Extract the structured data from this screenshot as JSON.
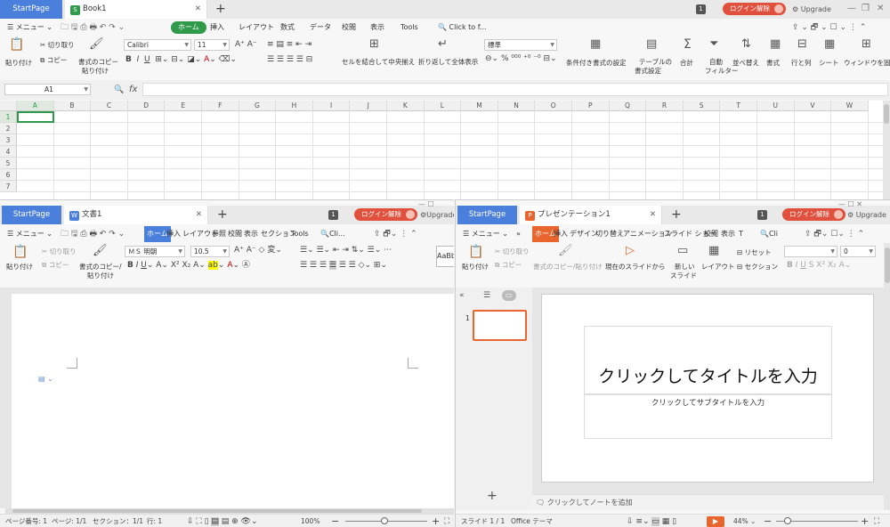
{
  "spreadsheet": {
    "tabs": {
      "start": "StartPage",
      "doc": "Book1",
      "doc_badge": "S",
      "doc_color": "#2e9a4a"
    },
    "num_badge": "1",
    "login": "ログイン解除",
    "upgrade": "Upgrade",
    "menu": {
      "menu_label": "メニュー",
      "active": "ホーム",
      "items": [
        "挿入",
        "レイアウト",
        "数式",
        "データ",
        "校閲",
        "表示",
        "Tools"
      ],
      "search": "Click to f..."
    },
    "ribbon": {
      "paste": "貼り付け",
      "cut": "切り取り",
      "copy": "コピー",
      "format_painter_1": "書式のコピー",
      "format_painter_2": "貼り付け",
      "font": "Calibri",
      "size": "11",
      "merge": "セルを結合して中央揃え",
      "wrap": "折り返して全体表示",
      "numfmt": "標準",
      "cond_fmt": "条件付き書式の設定",
      "table_fmt_1": "テーブルの",
      "table_fmt_2": "書式設定",
      "sum": "合計",
      "filter_1": "自動",
      "filter_2": "フィルター",
      "sort": "並べ替え",
      "format": "書式",
      "rowcol": "行と列",
      "sheet": "シート",
      "freeze": "ウィンドウを固定"
    },
    "namebox": "A1",
    "fx": "fx",
    "columns": [
      "A",
      "B",
      "C",
      "D",
      "E",
      "F",
      "G",
      "H",
      "I",
      "J",
      "K",
      "L",
      "M",
      "N",
      "O",
      "P",
      "Q",
      "R",
      "S",
      "T",
      "U",
      "V",
      "W"
    ],
    "rows": [
      "1",
      "2",
      "3",
      "4",
      "5",
      "6",
      "7"
    ]
  },
  "writer": {
    "tabs": {
      "start": "StartPage",
      "doc": "文書1",
      "doc_badge": "W",
      "doc_color": "#4a7fdc"
    },
    "num_badge": "1",
    "login": "ログイン解除",
    "upgrade": "Upgrade",
    "menu": {
      "menu_label": "メニュー",
      "active": "ホーム",
      "items": [
        "挿入",
        "レイアウト",
        "参照",
        "校閲",
        "表示",
        "セクション",
        "Tools"
      ],
      "search": "Cli..."
    },
    "ribbon": {
      "paste": "貼り付け",
      "cut": "切り取り",
      "copy": "コピー",
      "format_painter_1": "書式のコピー/",
      "format_painter_2": "貼り付け",
      "font": "ＭＳ 明朝",
      "size": "10.5",
      "style": "AaBb"
    },
    "status": {
      "page_no": "ページ番号: 1",
      "pages": "ページ: 1/1",
      "section": "セクション：1/1",
      "line": "行: 1",
      "zoom": "100%"
    }
  },
  "presentation": {
    "tabs": {
      "start": "StartPage",
      "doc": "プレゼンテーション1",
      "doc_badge": "P",
      "doc_color": "#e8662e"
    },
    "num_badge": "1",
    "login": "ログイン解除",
    "upgrade": "Upgrade",
    "menu": {
      "menu_label": "メニュー",
      "active": "ホーム",
      "items": [
        "挿入",
        "デザイン",
        "切り替え",
        "アニメーション",
        "スライド ショー",
        "校閲",
        "表示",
        "T"
      ],
      "search": "Cli"
    },
    "ribbon": {
      "paste": "貼り付け",
      "cut": "切り取り",
      "copy": "コピー",
      "format_painter": "書式のコピー/貼り付け",
      "from_current": "現在のスライドから",
      "new_slide_1": "新しい",
      "new_slide_2": "スライド",
      "layout": "レイアウト",
      "reset": "リセット",
      "section": "セクション",
      "size": "0"
    },
    "slide_no": "1",
    "title_placeholder": "クリックしてタイトルを入力",
    "subtitle_placeholder": "クリックしてサブタイトルを入力",
    "notes_placeholder": "クリックしてノートを追加",
    "status": {
      "slide": "スライド 1 / 1",
      "theme": "Office テーマ",
      "zoom": "44%"
    }
  }
}
